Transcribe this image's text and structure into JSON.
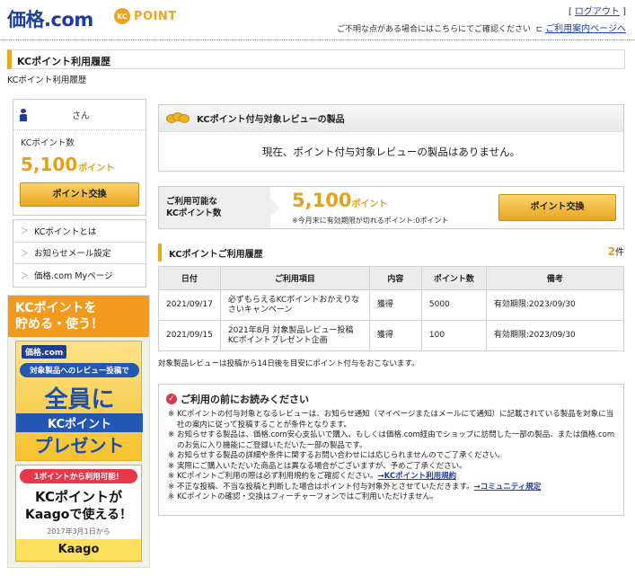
{
  "header": {
    "logo_kakaku": "価格",
    "logo_com": ".com",
    "logo_kc_circle": "KC",
    "logo_kc_word": "POINT",
    "logout_prefix": "[",
    "logout_link": "ログアウト",
    "logout_suffix": "]",
    "help_text": "ご不明な点がある場合にはこちらにてご確認ください",
    "help_link": "ご利用案内ページへ"
  },
  "page": {
    "title": "KCポイント利用履歴",
    "breadcrumb": "KCポイント利用履歴"
  },
  "user_panel": {
    "name_suffix": "さん",
    "points_label": "KCポイント数",
    "points_value": "5,100",
    "points_unit": "ポイント",
    "exchange_button": "ポイント交換"
  },
  "side_links": [
    {
      "label": "KCポイントとは"
    },
    {
      "label": "お知らせメール設定"
    },
    {
      "label": "価格.com Myページ"
    }
  ],
  "promo": {
    "top_line1": "KCポイントを",
    "top_line2": "貯める・使う！",
    "card1_brand": "価格.com",
    "card1_sub": "対象製品へのレビュー投稿で",
    "card1_big": "全員に",
    "card1_kc": "KCポイント",
    "card1_present": "プレゼント",
    "card2_pill": "1ポイントから利用可能！",
    "card2_line1": "KCポイントが",
    "card2_line2": "Kaagoで使える！",
    "card2_line3": "2017年3月1日から",
    "card2_kaago": "Kaago"
  },
  "review_box": {
    "title": "KCポイント付与対象レビューの製品",
    "message": "現在、ポイント付与対象レビューの製品はありません。"
  },
  "available": {
    "label_line1": "ご利用可能な",
    "label_line2": "KCポイント数",
    "value": "5,100",
    "unit": "ポイント",
    "note": "※今月末に有効期限が切れるポイント:0ポイント",
    "exchange_button": "ポイント交換"
  },
  "history": {
    "title": "KCポイントご利用履歴",
    "count": "2",
    "count_unit": "件",
    "columns": [
      "日付",
      "ご利用項目",
      "内容",
      "ポイント数",
      "備考"
    ],
    "rows": [
      {
        "date": "2021/09/17",
        "item": "必ずもらえるKCポイントおかえりなさいキャンペーン",
        "type": "獲得",
        "points": "5000",
        "note": "有効期限:2023/09/30"
      },
      {
        "date": "2021/09/15",
        "item": "2021年8月 対象製品レビュー投稿 KCポイントプレゼント企画",
        "type": "獲得",
        "points": "100",
        "note": "有効期限:2023/09/30"
      }
    ],
    "footnote": "対象製品レビューは投稿から14日後を目安にポイント付与をおこないます。"
  },
  "notice": {
    "title": "ご利用の前にお読みください",
    "items": [
      {
        "text": "KCポイントの付与対象となるレビューは、お知らせ通知（マイページまたはメールにて通知）に記載されている製品を対象に当社の案内に従って投稿することが条件となります。"
      },
      {
        "text": "お知らせする製品は、価格.com安心支払いで購入、もしくは価格.com経由でショップに訪問した一部の製品、または価格.comのお気に入り機能にご登録いただいた一部の製品です。"
      },
      {
        "text": "お知らせする製品の詳細や条件に関するお問い合わせには応じられませんのでご了承ください。"
      },
      {
        "text": "実際にご購入いただいた商品とは異なる場合がございますが、予めご了承ください。"
      },
      {
        "text": "KCポイントご利用の際は必ず利用規約をご確認ください。",
        "link": "→KCポイント利用規約"
      },
      {
        "text": "不正な投稿、不当な投稿と判断した場合はポイント付与対象外とさせていただきます。",
        "link": "→コミュニティ規定"
      },
      {
        "text": "KCポイントの確認・交換はフィーチャーフォンではご利用いただけません。"
      }
    ]
  },
  "colors": {
    "brand_blue": "#1d3f9a",
    "accent_gold": "#e5a11a",
    "promo_orange": "#f29a1c"
  }
}
